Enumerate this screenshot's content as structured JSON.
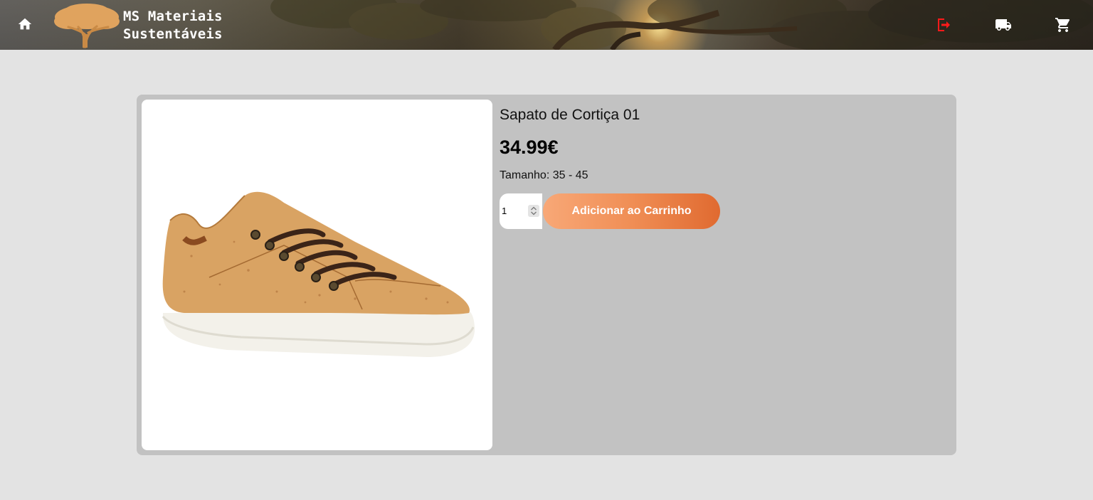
{
  "header": {
    "brand_line1": "MS Materiais",
    "brand_line2": "Sustentáveis",
    "icons": [
      "home-icon",
      "logout-icon",
      "truck-icon",
      "cart-icon"
    ],
    "logout_color": "#ff1a1a"
  },
  "product": {
    "name": "Sapato de Cortiça 01",
    "price": "34.99€",
    "size": "Tamanho: 35 - 45",
    "quantity": "1",
    "add_to_cart_label": "Adicionar ao Carrinho",
    "image": "cork-sneaker-image"
  },
  "colors": {
    "page_bg": "#e3e3e3",
    "card_bg": "#c2c2c2",
    "button_gradient_start": "#f8a877",
    "button_gradient_end": "#e06a30"
  }
}
